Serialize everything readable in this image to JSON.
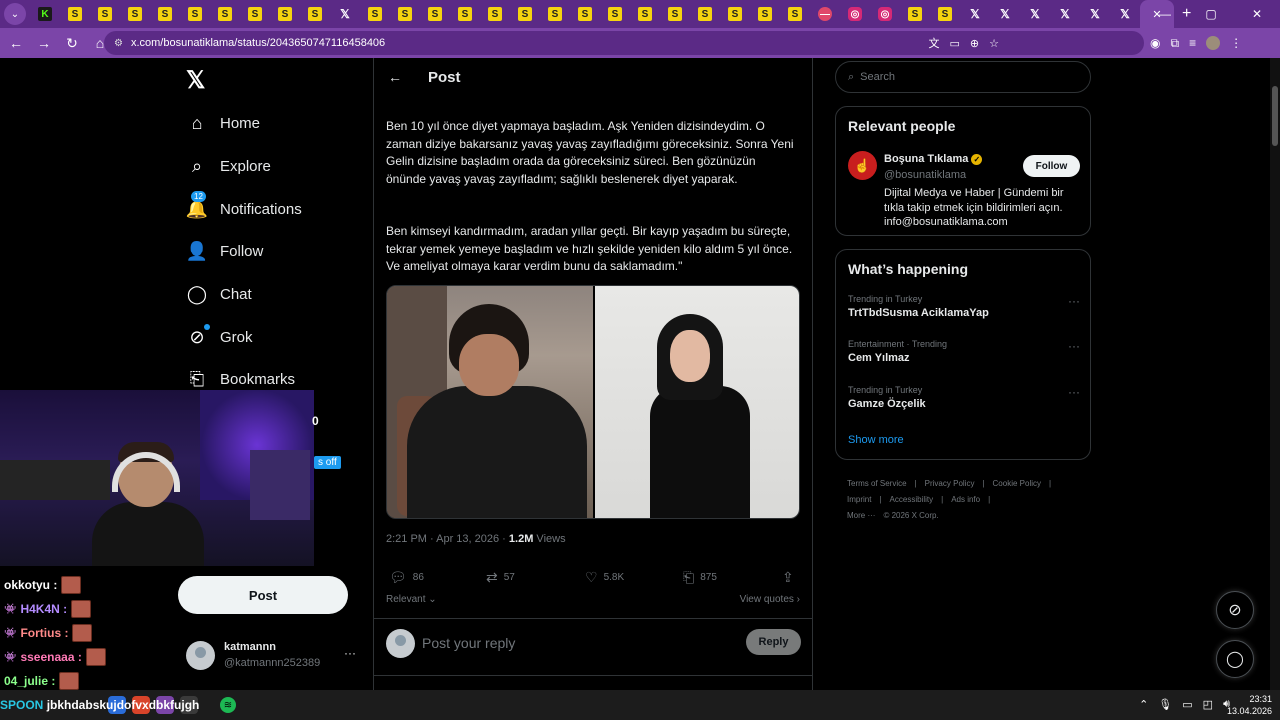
{
  "browser": {
    "tabs": [
      "kick",
      "s",
      "s",
      "s",
      "s",
      "s",
      "s",
      "s",
      "s",
      "s",
      "x",
      "s",
      "s",
      "s",
      "s",
      "s",
      "s",
      "s",
      "s",
      "s",
      "s",
      "s",
      "s",
      "s",
      "s",
      "s",
      "r",
      "i",
      "i",
      "s",
      "s",
      "x",
      "x",
      "x",
      "x",
      "x",
      "x"
    ],
    "url": "x.com/bosunatiklama/status/2043650747116458406",
    "window_controls": [
      "—",
      "▢",
      "✕"
    ]
  },
  "nav": {
    "logo": "𝕏",
    "items": [
      {
        "label": "Home",
        "icon": "home-icon",
        "glyph": "⌂"
      },
      {
        "label": "Explore",
        "icon": "search-icon",
        "glyph": "⌕"
      },
      {
        "label": "Notifications",
        "icon": "bell-icon",
        "glyph": "🔔",
        "badge": "12"
      },
      {
        "label": "Follow",
        "icon": "follow-icon",
        "glyph": "👤"
      },
      {
        "label": "Chat",
        "icon": "chat-icon",
        "glyph": "◯"
      },
      {
        "label": "Grok",
        "icon": "grok-icon",
        "glyph": "⊘"
      },
      {
        "label": "Bookmarks",
        "icon": "bookmark-icon",
        "glyph": "⎗"
      }
    ],
    "post_button": "Post",
    "account": {
      "name": "katmannn",
      "handle": "@katmannn252389",
      "more": "···"
    }
  },
  "overlay": {
    "off_label": "s off",
    "num": "0",
    "chat": [
      {
        "user": "okkotyu :",
        "color": "#ffffff",
        "badge": ""
      },
      {
        "user": "H4K4N :",
        "color": "#b48cff",
        "badge": "👾"
      },
      {
        "user": "Fortius :",
        "color": "#ff8a8a",
        "badge": "👾"
      },
      {
        "user": "sseenaaa :",
        "color": "#ff7ab6",
        "badge": "👾"
      },
      {
        "user": "04_julie :",
        "color": "#8cff8c",
        "badge": ""
      }
    ],
    "bottom_text_prefix": "SPOON",
    "bottom_text": "jbkhdabskujdofvxdbkfujgh"
  },
  "post": {
    "header_title": "Post",
    "back": "←",
    "paragraph1": "Ben 10 yıl önce diyet yapmaya başladım. Aşk Yeniden dizisindeydim. O zaman diziye bakarsanız yavaş yavaş zayıfladığımı göreceksiniz. Sonra Yeni Gelin dizisine başladım orada da göreceksiniz süreci. Ben gözünüzün önünde yavaş yavaş zayıfladım; sağlıklı beslenerek diyet yaparak.",
    "paragraph2": "Ben kimseyi kandırmadım, aradan yıllar geçti. Bir kayıp yaşadım bu süreçte, tekrar yemek yemeye başladım ve hızlı şekilde yeniden kilo aldım 5 yıl önce. Ve ameliyat olmaya karar verdim bunu da saklamadım.\"",
    "meta_time": "2:21 PM · Apr 13, 2026 · ",
    "meta_views": "1.2M",
    "meta_views_label": " Views",
    "replies": "86",
    "reposts": "57",
    "likes": "5.8K",
    "bookmarks": "875",
    "sort_label": "Relevant ⌄",
    "view_quotes": "View quotes ›",
    "reply_placeholder": "Post your reply",
    "reply_button": "Reply"
  },
  "sidebar": {
    "search_placeholder": "Search",
    "relevant_title": "Relevant people",
    "person": {
      "name": "Boşuna Tıklama",
      "handle": "@bosunatiklama",
      "bio": "Dijital Medya ve Haber | Gündemi bir tıkla takip etmek için bildirimleri açın. info@bosunatiklama.com",
      "follow": "Follow"
    },
    "happening_title": "What’s happening",
    "trends": [
      {
        "context": "Trending in Turkey",
        "name": "TrtTbdSusma AciklamaYap"
      },
      {
        "context": "Entertainment · Trending",
        "name": "Cem Yılmaz"
      },
      {
        "context": "Trending in Turkey",
        "name": "Gamze Özçelik"
      }
    ],
    "show_more": "Show more",
    "footer": [
      "Terms of Service",
      "|",
      "Privacy Policy",
      "|",
      "Cookie Policy",
      "|",
      "Imprint",
      "|",
      "Accessibility",
      "|",
      "Ads info",
      "|",
      "More ···",
      "© 2026 X Corp."
    ]
  },
  "taskbar": {
    "time": "23:31",
    "date": "13.04.2026"
  }
}
